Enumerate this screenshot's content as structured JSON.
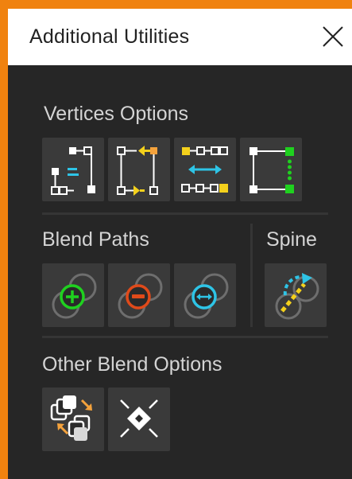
{
  "header": {
    "title": "Additional Utilities"
  },
  "sections": {
    "vertices": {
      "title": "Vertices Options"
    },
    "blend_paths": {
      "title": "Blend Paths"
    },
    "spine": {
      "title": "Spine"
    },
    "other_blend": {
      "title": "Other Blend Options"
    }
  },
  "icons": {
    "close": "close-icon",
    "vertices": [
      "align-vertices-icon",
      "swap-vertices-icon",
      "distribute-vertices-icon",
      "connect-vertices-icon"
    ],
    "blend_paths": [
      "add-blend-path-icon",
      "remove-blend-path-icon",
      "reverse-blend-path-icon"
    ],
    "spine": [
      "spine-icon"
    ],
    "other_blend": [
      "swap-objects-icon",
      "release-blend-icon"
    ]
  },
  "colors": {
    "accent_orange": "#f0820f",
    "cyan": "#2ec4e6",
    "yellow": "#f4d11c",
    "green": "#1fd11f",
    "red": "#e04a1a",
    "panel_bg": "#262626",
    "button_bg": "#3a3a3a"
  }
}
